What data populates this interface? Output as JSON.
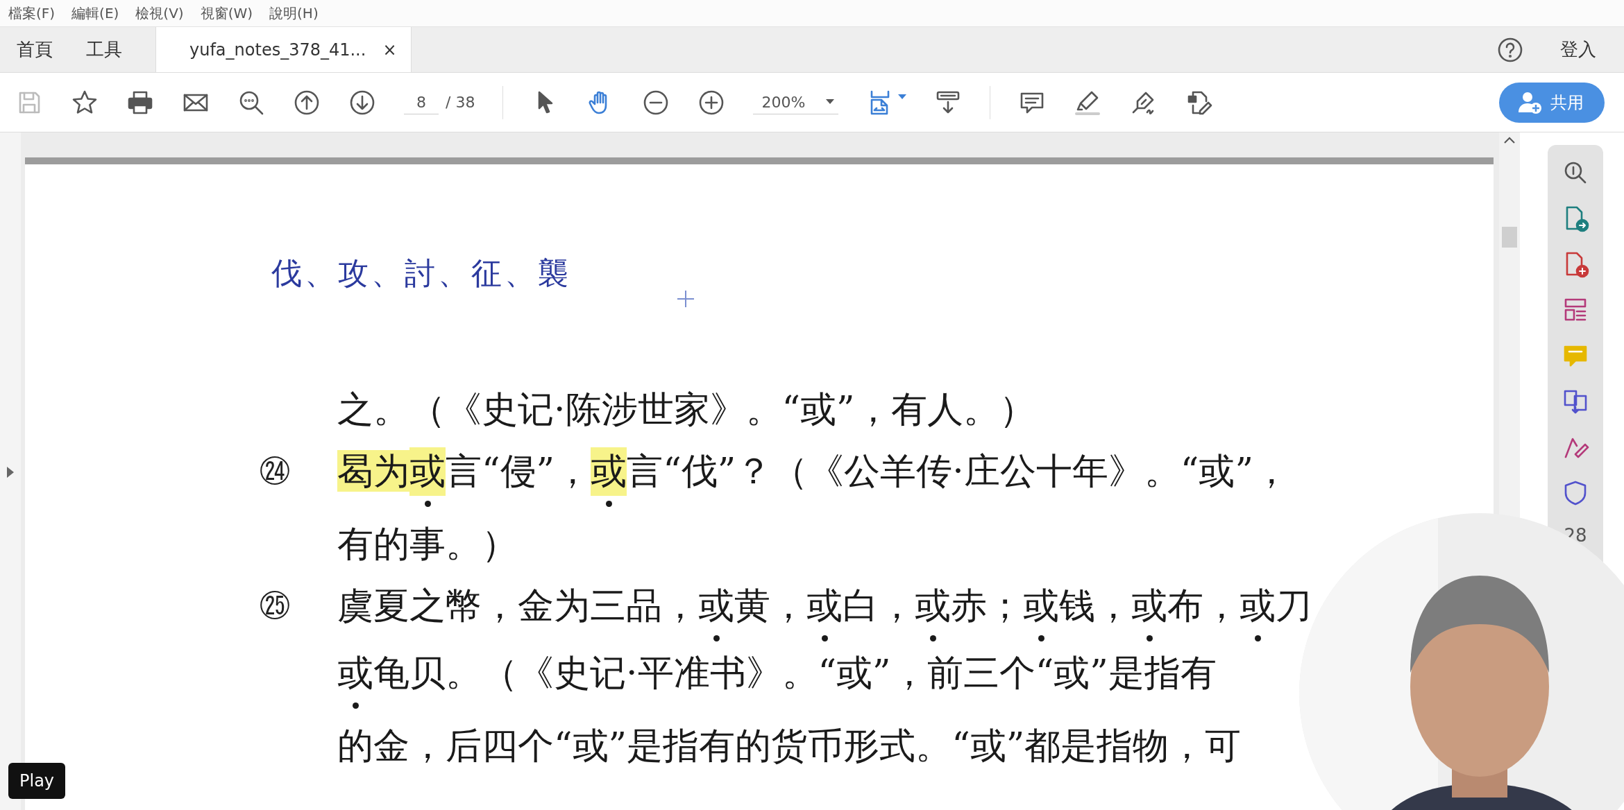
{
  "menu": [
    "檔案(F)",
    "編輯(E)",
    "檢視(V)",
    "視窗(W)",
    "說明(H)"
  ],
  "tabs": [
    {
      "label": "首頁",
      "selected": false
    },
    {
      "label": "工具",
      "selected": false
    },
    {
      "label": "yufa_notes_378_41...",
      "selected": true,
      "close": "×"
    }
  ],
  "sign_in": "登入",
  "toolbar": {
    "page": "8",
    "page_total": "/ 38",
    "zoom": "200%",
    "share": "共用"
  },
  "document": {
    "heading": "伐、攻、討、征、襲",
    "lines": [
      {
        "segments": [
          {
            "text": "之。（《史记·陈涉世家》。“或”，有人。）",
            "highlighted": false,
            "dotted": false
          }
        ]
      },
      {
        "number": "㉔",
        "segments": [
          {
            "text": "曷为",
            "highlighted": true,
            "dotted": false
          },
          {
            "text": "或",
            "highlighted": true,
            "dotted": true
          },
          {
            "text": "言“侵”，",
            "highlighted": false,
            "dotted": false
          },
          {
            "text": "或",
            "highlighted": true,
            "dotted": true
          },
          {
            "text": "言“伐”？（《公羊传·庄公十年》。“或”，",
            "highlighted": false,
            "dotted": false
          }
        ]
      },
      {
        "segments": [
          {
            "text": "有的事。）",
            "highlighted": false,
            "dotted": false
          }
        ]
      },
      {
        "number": "㉕",
        "segments": [
          {
            "text": "虞夏之幣，金为三品，",
            "highlighted": false,
            "dotted": false
          },
          {
            "text": "或",
            "highlighted": false,
            "dotted": true
          },
          {
            "text": "黄，",
            "highlighted": false,
            "dotted": false
          },
          {
            "text": "或",
            "highlighted": false,
            "dotted": true
          },
          {
            "text": "白，",
            "highlighted": false,
            "dotted": false
          },
          {
            "text": "或",
            "highlighted": false,
            "dotted": true
          },
          {
            "text": "赤；",
            "highlighted": false,
            "dotted": false
          },
          {
            "text": "或",
            "highlighted": false,
            "dotted": true
          },
          {
            "text": "钱，",
            "highlighted": false,
            "dotted": false
          },
          {
            "text": "或",
            "highlighted": false,
            "dotted": true
          },
          {
            "text": "布，",
            "highlighted": false,
            "dotted": false
          },
          {
            "text": "或",
            "highlighted": false,
            "dotted": true
          },
          {
            "text": "刀",
            "highlighted": false,
            "dotted": false
          }
        ]
      },
      {
        "segments": [
          {
            "text": "或",
            "highlighted": false,
            "dotted": true
          },
          {
            "text": "龟贝。（《史记·平准书》。“或”，前三个“或”是指有",
            "highlighted": false,
            "dotted": false
          }
        ]
      },
      {
        "segments": [
          {
            "text": "的金，后四个“或”是指有的货币形式。“或”都是指物，可",
            "highlighted": false,
            "dotted": false
          }
        ]
      }
    ]
  },
  "side_panel": {
    "count": "28"
  },
  "video": {
    "kind": "picture"
  },
  "tooltip": "Play"
}
